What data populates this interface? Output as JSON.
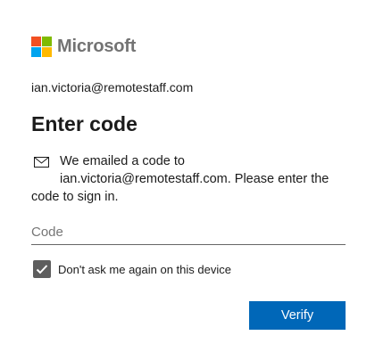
{
  "brand": {
    "name": "Microsoft",
    "logo_colors": [
      "#f25022",
      "#7fba00",
      "#00a4ef",
      "#ffb900"
    ]
  },
  "identity": {
    "email": "ian.victoria@remotestaff.com"
  },
  "heading": {
    "title": "Enter code"
  },
  "message": {
    "icon": "mail-icon",
    "line1": "We emailed a code to",
    "line2": "ian.victoria@remotestaff.com. Please enter the code to sign in."
  },
  "code_field": {
    "value": "",
    "placeholder": "Code"
  },
  "remember": {
    "checked": true,
    "label": "Don't ask me again on this device"
  },
  "actions": {
    "verify_label": "Verify"
  },
  "colors": {
    "accent": "#0067b8",
    "checkbox_fill": "#5e5e5e"
  }
}
